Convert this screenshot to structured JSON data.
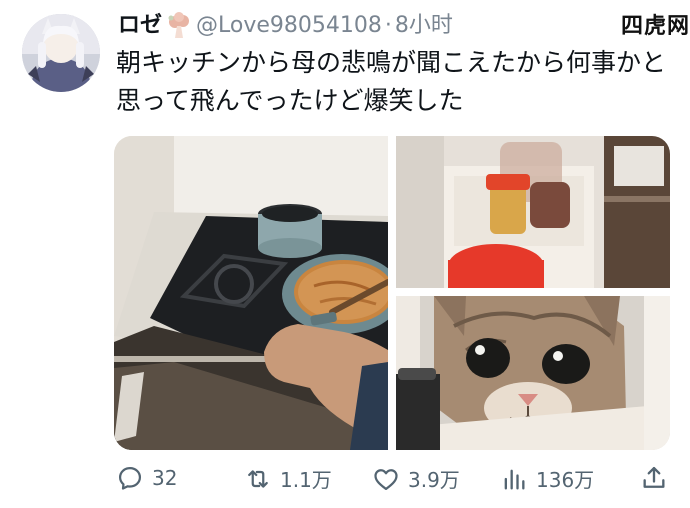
{
  "post": {
    "display_name": "ロゼ",
    "handle": "@Love98054108",
    "separator": "·",
    "time": "8小时",
    "text": "朝キッチンから母の悲鳴が聞こえたから何事かと思って飛んでったけど爆笑した"
  },
  "watermark": "四虎网",
  "actions": {
    "replies": "32",
    "reposts": "1.1万",
    "likes": "3.9万",
    "views": "136万"
  },
  "icons": [
    "reply-icon",
    "repost-icon",
    "like-icon",
    "views-icon",
    "share-icon"
  ]
}
